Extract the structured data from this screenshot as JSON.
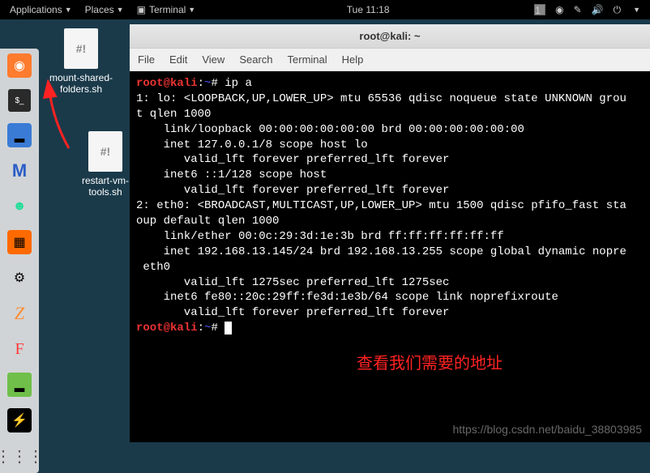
{
  "topbar": {
    "applications": "Applications",
    "places": "Places",
    "terminal": "Terminal",
    "clock": "Tue 11:18",
    "workspace": "1"
  },
  "desktop": {
    "file1": {
      "label": "mount-shared-folders.sh",
      "glyph": "#!"
    },
    "file2": {
      "label": "restart-vm-tools.sh",
      "glyph": "#!"
    }
  },
  "window": {
    "title": "root@kali: ~",
    "menus": {
      "file": "File",
      "edit": "Edit",
      "view": "View",
      "search": "Search",
      "terminal": "Terminal",
      "help": "Help"
    }
  },
  "term": {
    "user": "root@kali",
    "path": "~",
    "cmd": "ip a",
    "out1": "1: lo: <LOOPBACK,UP,LOWER_UP> mtu 65536 qdisc noqueue state UNKNOWN grou",
    "out2": "t qlen 1000",
    "out3": "    link/loopback 00:00:00:00:00:00 brd 00:00:00:00:00:00",
    "out4": "    inet 127.0.0.1/8 scope host lo",
    "out5": "       valid_lft forever preferred_lft forever",
    "out6": "    inet6 ::1/128 scope host",
    "out7": "       valid_lft forever preferred_lft forever",
    "out8": "2: eth0: <BROADCAST,MULTICAST,UP,LOWER_UP> mtu 1500 qdisc pfifo_fast sta",
    "out9": "oup default qlen 1000",
    "out10": "    link/ether 00:0c:29:3d:1e:3b brd ff:ff:ff:ff:ff:ff",
    "out11": "    inet 192.168.13.145/24 brd 192.168.13.255 scope global dynamic nopre",
    "out12": " eth0",
    "out13": "       valid_lft 1275sec preferred_lft 1275sec",
    "out14": "    inet6 fe80::20c:29ff:fe3d:1e3b/64 scope link noprefixroute",
    "out15": "       valid_lft forever preferred_lft forever"
  },
  "annotation": "查看我们需要的地址",
  "watermark": "https://blog.csdn.net/baidu_38803985"
}
